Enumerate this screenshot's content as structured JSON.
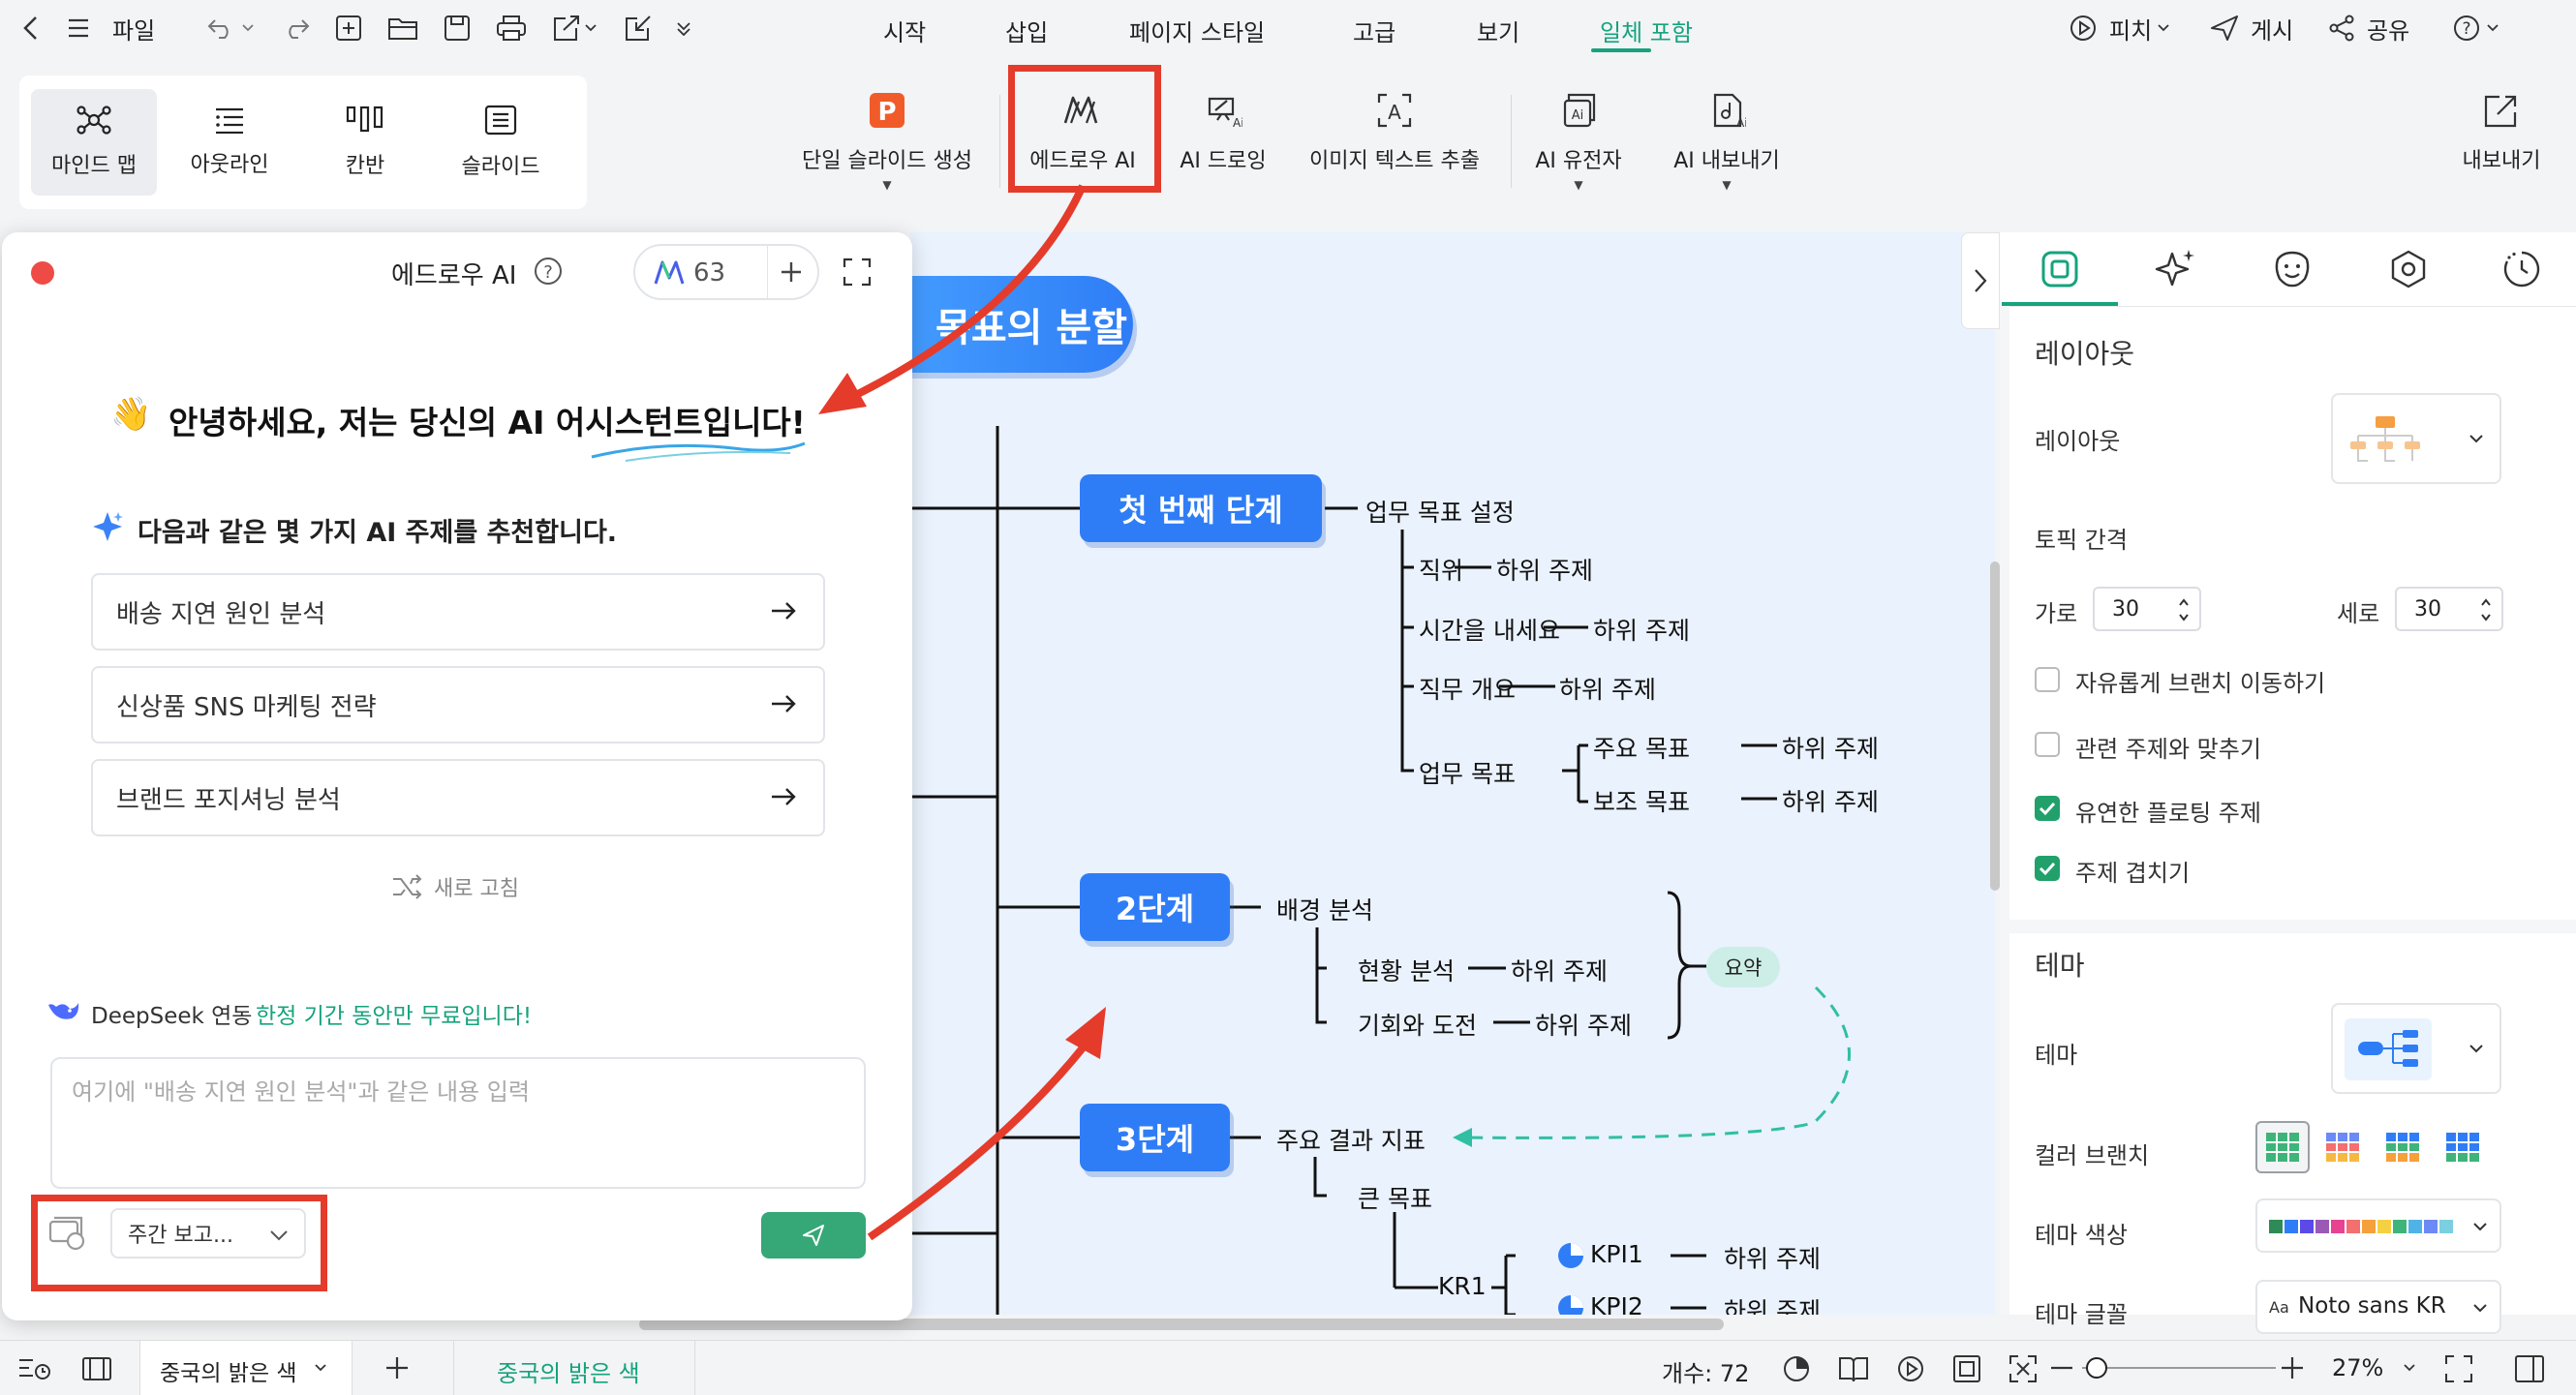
{
  "topbar": {
    "file_label": "파일",
    "menus": [
      "시작",
      "삽입",
      "페이지 스타일",
      "고급",
      "보기",
      "일체 포함"
    ],
    "active_menu": "일체 포함",
    "pitch_label": "피치",
    "post_label": "게시",
    "share_label": "공유"
  },
  "views": {
    "mindmap": "마인드 맵",
    "outline": "아웃라인",
    "kanban": "칸반",
    "slide": "슬라이드"
  },
  "ribbon": {
    "single_slide": "단일 슬라이드 생성",
    "edraw_ai": "에드로우 AI",
    "ai_drawing": "AI 드로잉",
    "image_text": "이미지 텍스트 추출",
    "ai_gene": "AI 유전자",
    "ai_export": "AI 내보내기",
    "export": "내보내기"
  },
  "ai_panel": {
    "title": "에드로우 AI",
    "credits": "63",
    "greeting": "안녕하세요, 저는 당신의 AI 어시스턴트입니다!",
    "greeting_emoji": "👋",
    "recommend": "다음과 같은 몇 가지 AI 주제를 추천합니다.",
    "suggestions": [
      "배송 지연 원인 분석",
      "신상품 SNS 마케팅 전략",
      "브랜드 포지셔닝 분석"
    ],
    "refresh": "새로 고침",
    "deepseek": "DeepSeek 연동",
    "promo": "한정 기간 동안만 무료입니다!",
    "input_placeholder": "여기에 \"배송 지연 원인 분석\"과 같은 내용 입력",
    "template_select": "주간 보고..."
  },
  "mindmap": {
    "root": "목표의 분할",
    "stage1": "첫 번째 단계",
    "stage1_child": "업무 목표 설정",
    "stage1_items": [
      "직위",
      "시간을 내세요",
      "직무 개요",
      "업무 목표"
    ],
    "sub_topic": "하위 주제",
    "main_goal": "주요 목표",
    "sub_goal": "보조 목표",
    "stage2": "2단계",
    "stage2_child": "배경 분석",
    "stage2_items": [
      "현황 분석",
      "기회와 도전"
    ],
    "summary": "요약",
    "stage3": "3단계",
    "stage3_child": "주요 결과 지표",
    "big_goal": "큰 목표",
    "kr1": "KR1",
    "kpi1": "KPI1",
    "kpi2": "KPI2"
  },
  "right_panel": {
    "layout_section": "레이아웃",
    "layout_label": "레이아웃",
    "topic_spacing": "토픽 간격",
    "horizontal": "가로",
    "horizontal_value": "30",
    "vertical": "세로",
    "vertical_value": "30",
    "checkboxes": [
      {
        "label": "자유롭게 브랜치 이동하기",
        "checked": false
      },
      {
        "label": "관련 주제와 맞추기",
        "checked": false
      },
      {
        "label": "유연한 플로팅 주제",
        "checked": true
      },
      {
        "label": "주제 겹치기",
        "checked": true
      }
    ],
    "theme_section": "테마",
    "theme_label": "테마",
    "color_branch": "컬러 브랜치",
    "theme_color": "테마 색상",
    "theme_font": "테마 글꼴",
    "font_value": "Noto sans KR",
    "font_prefix": "Aa"
  },
  "bottombar": {
    "page_tab": "중국의 밝은 색",
    "page_tab_active": "중국의 밝은 색",
    "count": "개수: 72",
    "zoom": "27%"
  },
  "colors": {
    "accent_green": "#16a37d",
    "topic_blue": "#2f7df6",
    "highlight_red": "#e53b2b"
  }
}
